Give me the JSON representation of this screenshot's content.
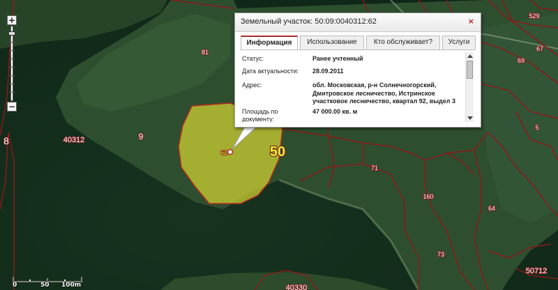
{
  "map": {
    "accent_color": "#a52a2a",
    "parcel_fill": "#d3d230",
    "parcel_labels": [
      "529",
      "81",
      "67",
      "69",
      "9",
      "40312",
      "8",
      "50",
      "71",
      "5",
      "160",
      "64",
      "73",
      "50712",
      "40330"
    ],
    "selected_marker_label": "62"
  },
  "zoom": {
    "plus_icon": "+",
    "minus_icon": "−",
    "level_fraction": 0.93
  },
  "scale": {
    "zero": "0",
    "mid": "50",
    "end": "100m"
  },
  "popup": {
    "title": "Земельный участок: 50:09:0040312:62",
    "close_icon": "×",
    "tabs": [
      "Информация",
      "Использование",
      "Кто обслуживает?",
      "Услуги"
    ],
    "active_tab": 0,
    "rows": [
      {
        "key": "Статус:",
        "value": "Ранее учтенный"
      },
      {
        "key": "Дата актуальности:",
        "value": "28.09.2011"
      },
      {
        "key": "Адрес:",
        "value": "обл. Московская, р-н Солнечногорский, Дмитровское лесничество, Истринское участковое лесничество, квартал 92, выдел 3"
      },
      {
        "key": "Площадь по документу:",
        "value": "47 000.00 кв. м"
      }
    ]
  }
}
